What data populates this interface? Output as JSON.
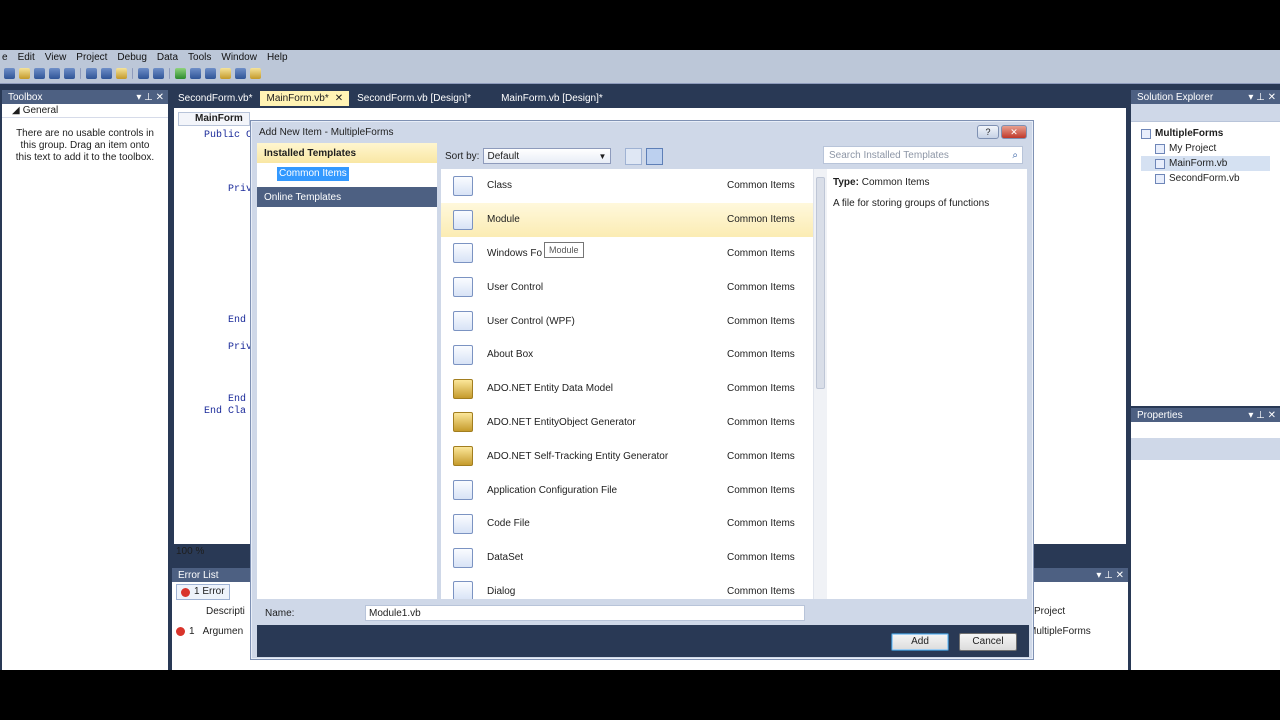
{
  "menu": [
    "e",
    "Edit",
    "View",
    "Project",
    "Debug",
    "Data",
    "Tools",
    "Window",
    "Help"
  ],
  "toolbox": {
    "title": "Toolbox",
    "group": "General",
    "message": "There are no usable controls in this group. Drag an item onto this text to add it to the toolbox."
  },
  "doc_tabs": [
    "SecondForm.vb*",
    "MainForm.vb*",
    "SecondForm.vb [Design]*",
    "MainForm.vb [Design]*"
  ],
  "editor": {
    "class_dropdown": "MainForm",
    "lines": [
      "Public C",
      "Priv",
      "End",
      "Priv",
      "End",
      "End Cla"
    ],
    "zoom": "100 %"
  },
  "error_list": {
    "title": "Error List",
    "errors_button": "1 Error",
    "col_description": "Descripti",
    "col_project": "Project",
    "row_num": "1",
    "row_desc": "Argumen",
    "row_project": "MultipleForms"
  },
  "solution_explorer": {
    "title": "Solution Explorer",
    "root": "MultipleForms",
    "items": [
      "My Project",
      "MainForm.vb",
      "SecondForm.vb"
    ]
  },
  "properties": {
    "title": "Properties"
  },
  "dialog": {
    "title": "Add New Item - MultipleForms",
    "help_btn": "?",
    "close_btn": "✕",
    "installed_templates": "Installed Templates",
    "common_items": "Common Items",
    "online_templates": "Online Templates",
    "sort_label": "Sort by:",
    "sort_value": "Default",
    "search_placeholder": "Search Installed Templates",
    "items": [
      {
        "name": "Class",
        "category": "Common Items"
      },
      {
        "name": "Module",
        "category": "Common Items"
      },
      {
        "name": "Windows Fo",
        "category": "Common Items"
      },
      {
        "name": "User Control",
        "category": "Common Items"
      },
      {
        "name": "User Control (WPF)",
        "category": "Common Items"
      },
      {
        "name": "About Box",
        "category": "Common Items"
      },
      {
        "name": "ADO.NET Entity Data Model",
        "category": "Common Items"
      },
      {
        "name": "ADO.NET EntityObject Generator",
        "category": "Common Items"
      },
      {
        "name": "ADO.NET Self-Tracking Entity Generator",
        "category": "Common Items"
      },
      {
        "name": "Application Configuration File",
        "category": "Common Items"
      },
      {
        "name": "Code File",
        "category": "Common Items"
      },
      {
        "name": "DataSet",
        "category": "Common Items"
      },
      {
        "name": "Dialog",
        "category": "Common Items"
      }
    ],
    "tooltip": "Module",
    "detail_type_label": "Type:",
    "detail_type_value": "Common Items",
    "detail_desc": "A file for storing groups of functions",
    "name_label": "Name:",
    "name_value": "Module1.vb",
    "add_btn": "Add",
    "cancel_btn": "Cancel"
  }
}
